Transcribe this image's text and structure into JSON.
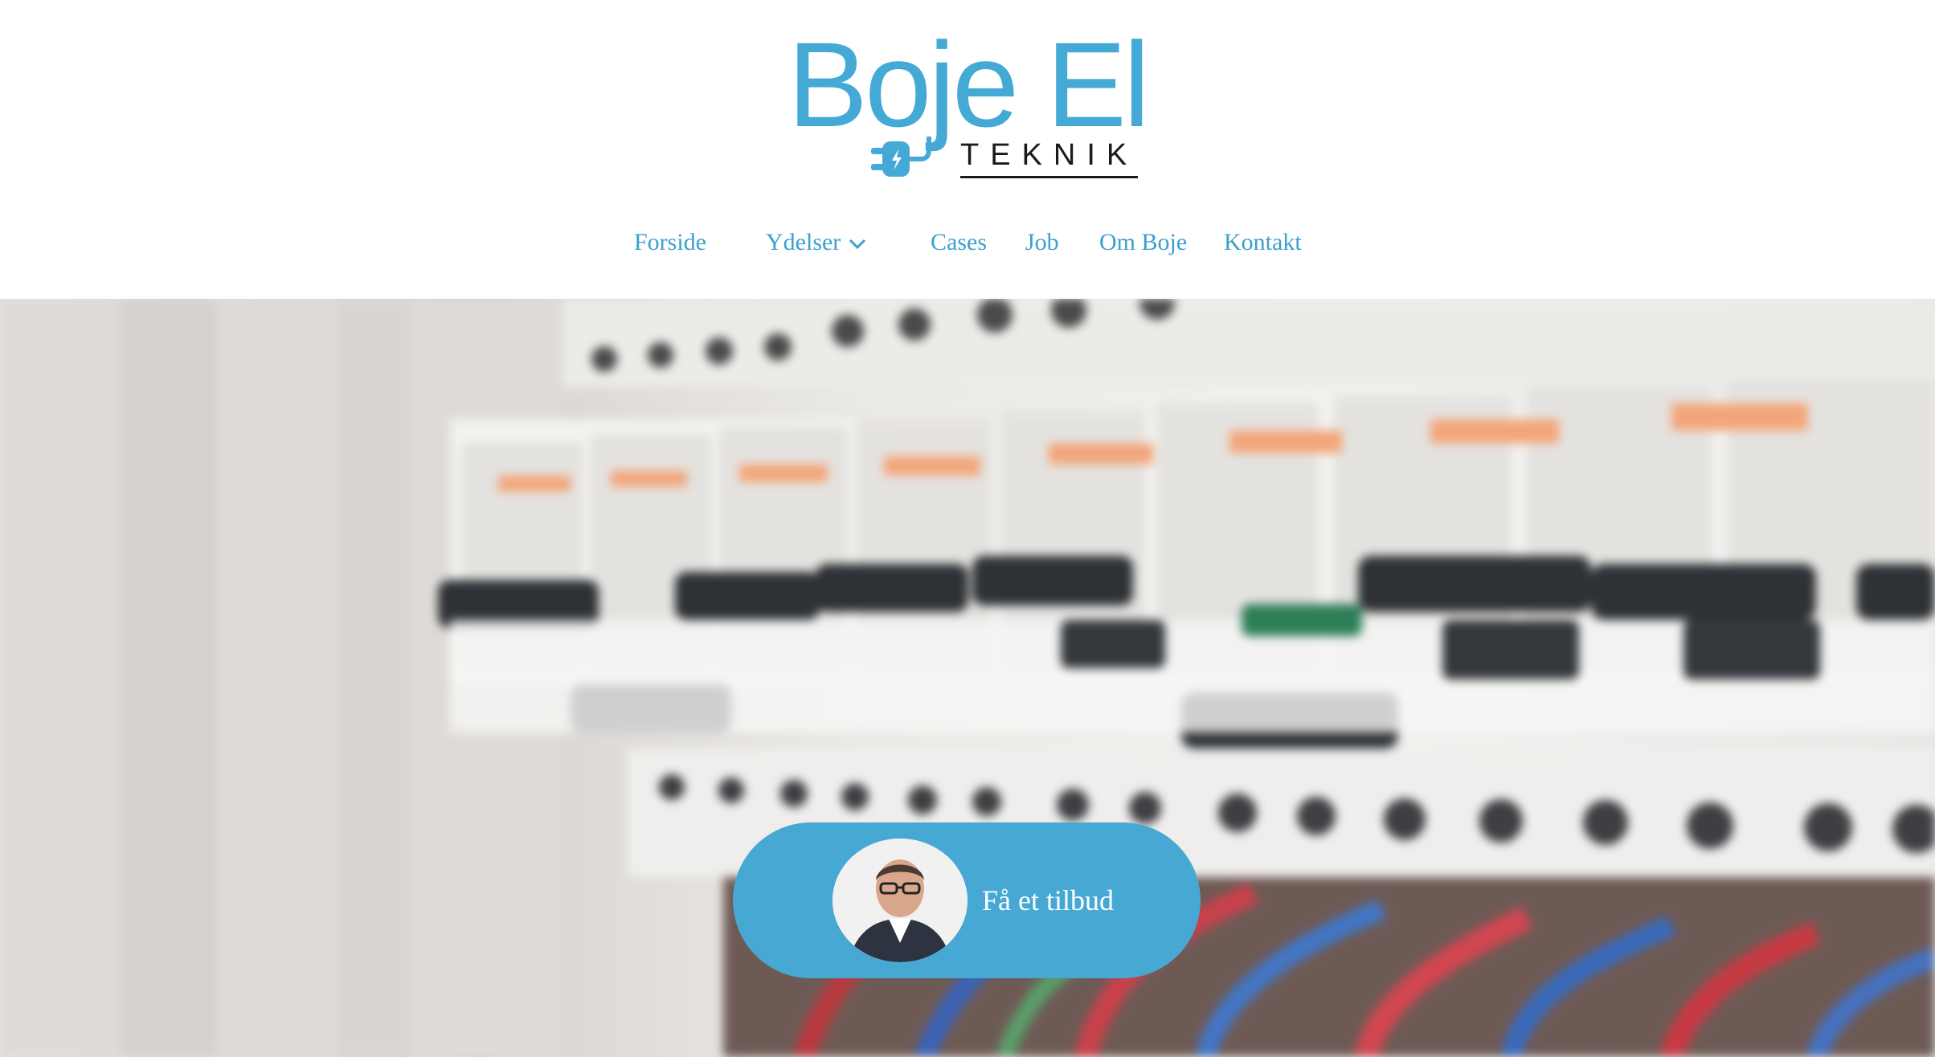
{
  "brand": {
    "name": "Boje El",
    "tagline": "TEKNIK",
    "color": "#45a9d5"
  },
  "nav": {
    "items": [
      {
        "label": "Forside"
      },
      {
        "label": "Ydelser",
        "has_dropdown": true
      },
      {
        "label": "Cases"
      },
      {
        "label": "Job"
      },
      {
        "label": "Om Boje"
      },
      {
        "label": "Kontakt"
      }
    ],
    "color": "#3aa0cf"
  },
  "hero": {
    "cta_label": "Få et tilbud",
    "cta_color": "#48a8d4"
  },
  "icons": {
    "logo_mark": "plug-icon",
    "dropdown": "chevron-down-icon"
  }
}
